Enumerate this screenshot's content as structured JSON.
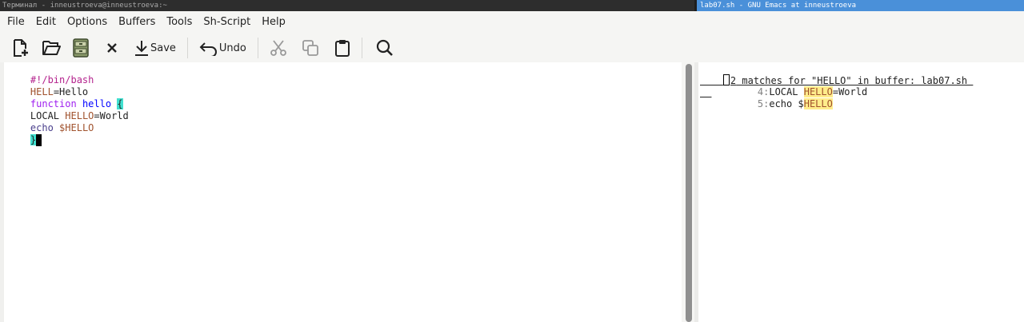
{
  "taskbar": {
    "left_title": "Терминал - inneustroeva@inneustroeva:~",
    "right_title": "lab07.sh - GNU Emacs at inneustroeva"
  },
  "menu": [
    "File",
    "Edit",
    "Options",
    "Buffers",
    "Tools",
    "Sh-Script",
    "Help"
  ],
  "toolbar": {
    "save_label": "Save",
    "undo_label": "Undo"
  },
  "editor": {
    "line1": "#!/bin/bash",
    "line2_var": "HELL",
    "line2_rest": "=Hello",
    "line3_kw": "function",
    "line3_fn": "hello",
    "line3_brace": "{",
    "line4_local": "LOCAL ",
    "line4_var": "HELLO",
    "line4_rest": "=World",
    "line5_echo": "echo",
    "line5_var": "$HELLO",
    "line6_brace": "}"
  },
  "occur": {
    "header_count": "2",
    "header_rest": " matches for \"HELLO\" in buffer: lab07.sh ",
    "matches": [
      {
        "num": "4:",
        "before": "LOCAL ",
        "match": "HELLO",
        "after": "=World"
      },
      {
        "num": "5:",
        "before": "echo $",
        "match": "HELLO",
        "after": ""
      }
    ]
  },
  "colors": {
    "taskbar_active": "#4a90d9",
    "highlight": "#ffec8b",
    "paren_match": "#40e0d0"
  }
}
